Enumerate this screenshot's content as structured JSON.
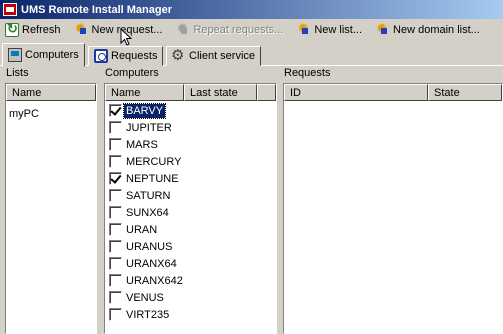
{
  "window": {
    "title": "UMS Remote Install Manager"
  },
  "toolbar": {
    "refresh": "Refresh",
    "new_request": "New request...",
    "repeat_requests": "Repeat requests...",
    "new_list": "New list...",
    "new_domain_list": "New domain list..."
  },
  "tabs": [
    {
      "label": "Computers",
      "icon": "computers-icon",
      "active": true
    },
    {
      "label": "Requests",
      "icon": "requests-icon",
      "active": false
    },
    {
      "label": "Client service",
      "icon": "gears-icon",
      "active": false
    }
  ],
  "lists": {
    "label": "Lists",
    "column": "Name",
    "items": [
      "myPC"
    ]
  },
  "computers": {
    "label": "Computers",
    "columns": [
      "Name",
      "Last state"
    ],
    "items": [
      {
        "name": "BARVY",
        "checked": true,
        "selected": true
      },
      {
        "name": "JUPITER",
        "checked": false,
        "selected": false
      },
      {
        "name": "MARS",
        "checked": false,
        "selected": false
      },
      {
        "name": "MERCURY",
        "checked": false,
        "selected": false
      },
      {
        "name": "NEPTUNE",
        "checked": true,
        "selected": false
      },
      {
        "name": "SATURN",
        "checked": false,
        "selected": false
      },
      {
        "name": "SUNX64",
        "checked": false,
        "selected": false
      },
      {
        "name": "URAN",
        "checked": false,
        "selected": false
      },
      {
        "name": "URANUS",
        "checked": false,
        "selected": false
      },
      {
        "name": "URANX64",
        "checked": false,
        "selected": false
      },
      {
        "name": "URANX642",
        "checked": false,
        "selected": false
      },
      {
        "name": "VENUS",
        "checked": false,
        "selected": false
      },
      {
        "name": "VIRT235",
        "checked": false,
        "selected": false
      }
    ]
  },
  "requests": {
    "label": "Requests",
    "columns": [
      "ID",
      "State"
    ]
  },
  "colors": {
    "titlebar": "#0a246a",
    "selection": "#0a246a",
    "face": "#d4d0c8"
  }
}
